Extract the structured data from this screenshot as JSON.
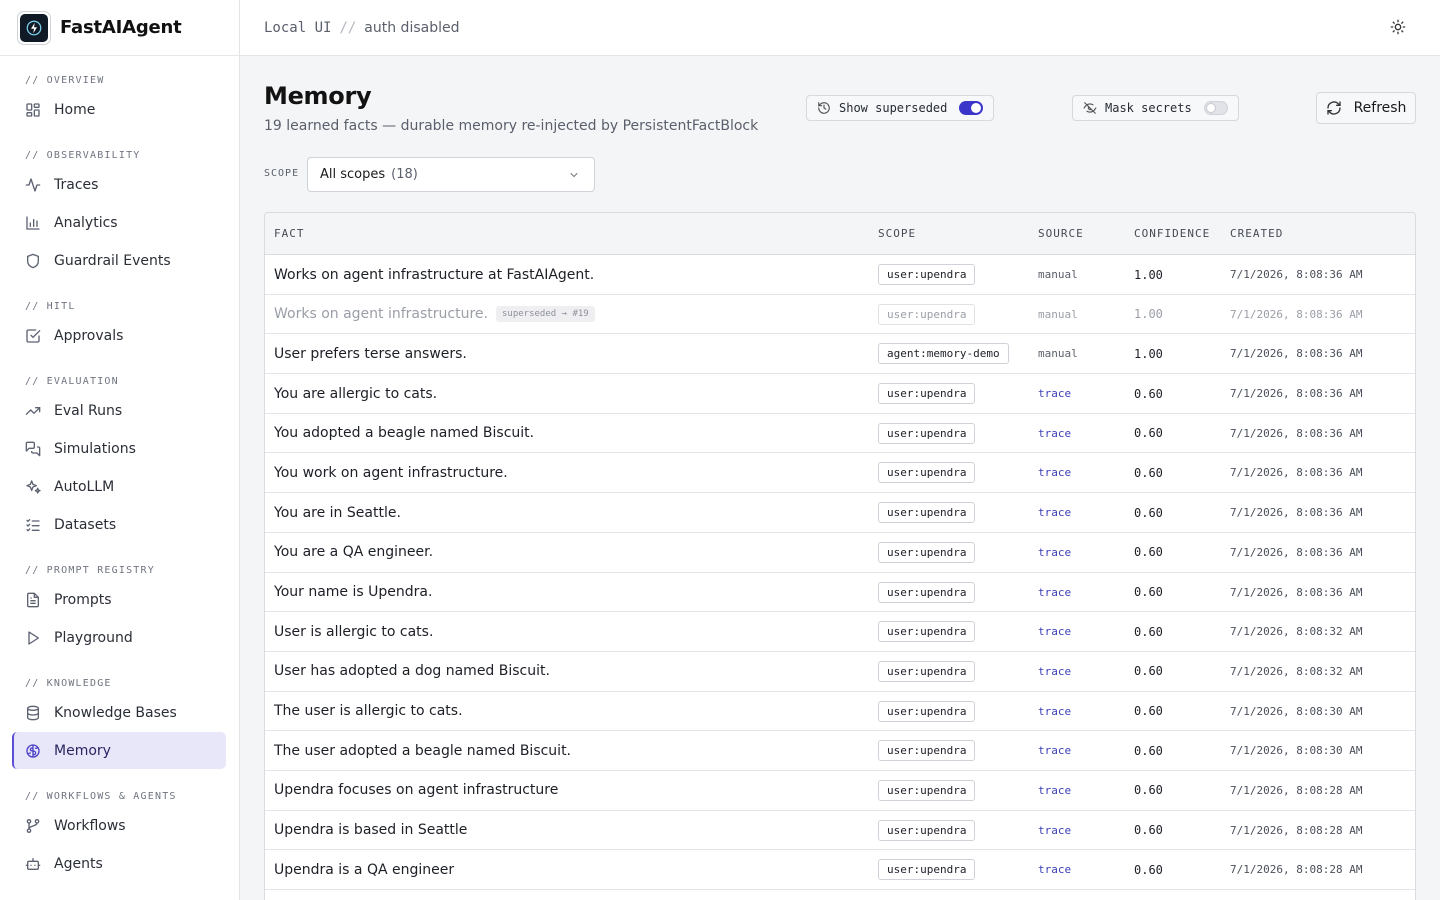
{
  "app": {
    "name": "FastAIAgent"
  },
  "header": {
    "mode": "Local UI",
    "separator": "//",
    "auth": "auth disabled"
  },
  "sidebar": {
    "sections": [
      {
        "label": "// OVERVIEW",
        "items": [
          {
            "label": "Home",
            "icon": "dashboard-icon"
          }
        ]
      },
      {
        "label": "// OBSERVABILITY",
        "items": [
          {
            "label": "Traces",
            "icon": "activity-icon"
          },
          {
            "label": "Analytics",
            "icon": "bar-chart-icon"
          },
          {
            "label": "Guardrail Events",
            "icon": "shield-icon"
          }
        ]
      },
      {
        "label": "// HITL",
        "items": [
          {
            "label": "Approvals",
            "icon": "check-square-icon"
          }
        ]
      },
      {
        "label": "// EVALUATION",
        "items": [
          {
            "label": "Eval Runs",
            "icon": "trending-up-icon"
          },
          {
            "label": "Simulations",
            "icon": "chat-bubbles-icon"
          },
          {
            "label": "AutoLLM",
            "icon": "sparkles-icon"
          },
          {
            "label": "Datasets",
            "icon": "list-check-icon"
          }
        ]
      },
      {
        "label": "// PROMPT REGISTRY",
        "items": [
          {
            "label": "Prompts",
            "icon": "file-text-icon"
          },
          {
            "label": "Playground",
            "icon": "play-icon"
          }
        ]
      },
      {
        "label": "// KNOWLEDGE",
        "items": [
          {
            "label": "Knowledge Bases",
            "icon": "database-icon"
          },
          {
            "label": "Memory",
            "icon": "brain-icon",
            "active": true
          }
        ]
      },
      {
        "label": "// WORKFLOWS & AGENTS",
        "items": [
          {
            "label": "Workflows",
            "icon": "git-branch-icon"
          },
          {
            "label": "Agents",
            "icon": "bot-icon"
          }
        ]
      }
    ]
  },
  "page": {
    "title": "Memory",
    "subtitle": "19 learned facts — durable memory re-injected by PersistentFactBlock",
    "show_superseded": {
      "label": "Show superseded",
      "on": true
    },
    "mask_secrets": {
      "label": "Mask secrets",
      "on": false
    },
    "refresh_label": "Refresh",
    "scope_filter": {
      "label": "SCOPE",
      "value": "All scopes",
      "count": "(18)"
    }
  },
  "table": {
    "columns": {
      "fact": "FACT",
      "scope": "SCOPE",
      "source": "SOURCE",
      "confidence": "CONFIDENCE",
      "created": "CREATED"
    },
    "rows": [
      {
        "fact": "Works on agent infrastructure at FastAIAgent.",
        "scope": "user:upendra",
        "source": "manual",
        "confidence": "1.00",
        "created": "7/1/2026, 8:08:36 AM"
      },
      {
        "fact": "Works on agent infrastructure.",
        "badge": "superseded → #19",
        "superseded": true,
        "scope": "user:upendra",
        "source": "manual",
        "confidence": "1.00",
        "created": "7/1/2026, 8:08:36 AM"
      },
      {
        "fact": "User prefers terse answers.",
        "scope": "agent:memory-demo",
        "source": "manual",
        "confidence": "1.00",
        "created": "7/1/2026, 8:08:36 AM"
      },
      {
        "fact": "You are allergic to cats.",
        "scope": "user:upendra",
        "source": "trace",
        "confidence": "0.60",
        "created": "7/1/2026, 8:08:36 AM"
      },
      {
        "fact": "You adopted a beagle named Biscuit.",
        "scope": "user:upendra",
        "source": "trace",
        "confidence": "0.60",
        "created": "7/1/2026, 8:08:36 AM"
      },
      {
        "fact": "You work on agent infrastructure.",
        "scope": "user:upendra",
        "source": "trace",
        "confidence": "0.60",
        "created": "7/1/2026, 8:08:36 AM"
      },
      {
        "fact": "You are in Seattle.",
        "scope": "user:upendra",
        "source": "trace",
        "confidence": "0.60",
        "created": "7/1/2026, 8:08:36 AM"
      },
      {
        "fact": "You are a QA engineer.",
        "scope": "user:upendra",
        "source": "trace",
        "confidence": "0.60",
        "created": "7/1/2026, 8:08:36 AM"
      },
      {
        "fact": "Your name is Upendra.",
        "scope": "user:upendra",
        "source": "trace",
        "confidence": "0.60",
        "created": "7/1/2026, 8:08:36 AM"
      },
      {
        "fact": "User is allergic to cats.",
        "scope": "user:upendra",
        "source": "trace",
        "confidence": "0.60",
        "created": "7/1/2026, 8:08:32 AM"
      },
      {
        "fact": "User has adopted a dog named Biscuit.",
        "scope": "user:upendra",
        "source": "trace",
        "confidence": "0.60",
        "created": "7/1/2026, 8:08:32 AM"
      },
      {
        "fact": "The user is allergic to cats.",
        "scope": "user:upendra",
        "source": "trace",
        "confidence": "0.60",
        "created": "7/1/2026, 8:08:30 AM"
      },
      {
        "fact": "The user adopted a beagle named Biscuit.",
        "scope": "user:upendra",
        "source": "trace",
        "confidence": "0.60",
        "created": "7/1/2026, 8:08:30 AM"
      },
      {
        "fact": "Upendra focuses on agent infrastructure",
        "scope": "user:upendra",
        "source": "trace",
        "confidence": "0.60",
        "created": "7/1/2026, 8:08:28 AM"
      },
      {
        "fact": "Upendra is based in Seattle",
        "scope": "user:upendra",
        "source": "trace",
        "confidence": "0.60",
        "created": "7/1/2026, 8:08:28 AM"
      },
      {
        "fact": "Upendra is a QA engineer",
        "scope": "user:upendra",
        "source": "trace",
        "confidence": "0.60",
        "created": "7/1/2026, 8:08:28 AM"
      }
    ]
  },
  "colors": {
    "accent": "#3b35c9",
    "active_nav_bg": "#e8e7fa",
    "trace_link": "#3b3fb8"
  }
}
